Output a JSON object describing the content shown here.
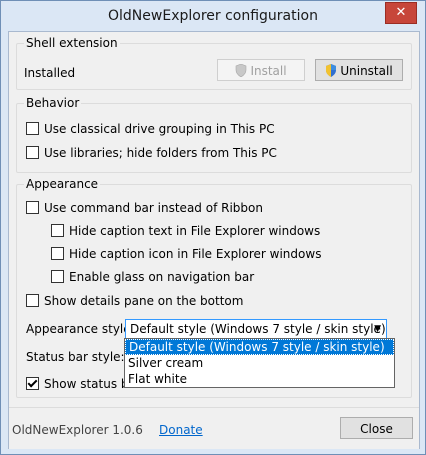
{
  "window": {
    "title": "OldNewExplorer configuration",
    "close_glyph": "✕"
  },
  "shell": {
    "legend": "Shell extension",
    "status": "Installed",
    "install_label": "Install",
    "uninstall_label": "Uninstall"
  },
  "behavior": {
    "legend": "Behavior",
    "items": [
      {
        "label": "Use classical drive grouping in This PC",
        "checked": false
      },
      {
        "label": "Use libraries; hide folders from This PC",
        "checked": false
      }
    ]
  },
  "appearance": {
    "legend": "Appearance",
    "command_bar": {
      "label": "Use command bar instead of Ribbon",
      "checked": false
    },
    "sub_items": [
      {
        "label": "Hide caption text in File Explorer windows",
        "checked": false
      },
      {
        "label": "Hide caption icon in File Explorer windows",
        "checked": false
      },
      {
        "label": "Enable glass on navigation bar",
        "checked": false
      }
    ],
    "details_pane": {
      "label": "Show details pane on the bottom",
      "checked": false
    },
    "style_label": "Appearance style:",
    "style_value": "Default style (Windows 7 style / skin style)",
    "style_options": [
      "Default style (Windows 7 style / skin style)",
      "Silver cream",
      "Flat white"
    ],
    "status_bar_style_label": "Status bar style:",
    "show_status_bar": {
      "label": "Show status bar",
      "checked": true
    }
  },
  "footer": {
    "version": "OldNewExplorer 1.0.6",
    "donate_label": "Donate",
    "close_label": "Close"
  }
}
